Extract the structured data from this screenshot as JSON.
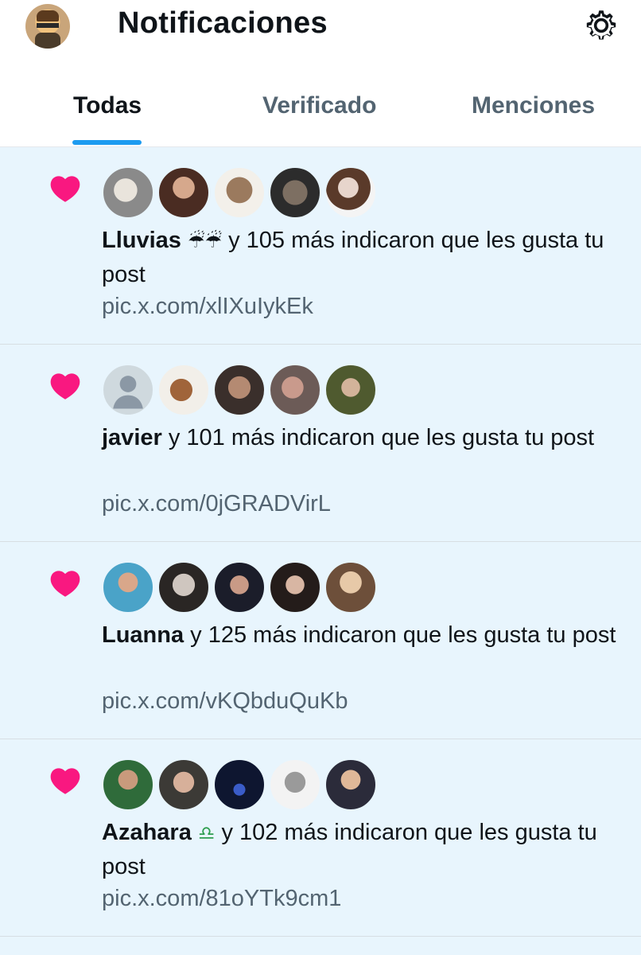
{
  "header": {
    "title": "Notificaciones",
    "settings_icon": "gear-icon"
  },
  "tabs": [
    {
      "label": "Todas",
      "active": true
    },
    {
      "label": "Verificado",
      "active": false
    },
    {
      "label": "Menciones",
      "active": false
    }
  ],
  "notifications": [
    {
      "name": "Lluvias",
      "emoji": "☔☔",
      "text": " y 105 más indicaron que les gusta tu post",
      "link": "pic.x.com/xlIXuIykEk"
    },
    {
      "name": "javier",
      "emoji": "",
      "text": " y 101 más indicaron que les gusta tu post",
      "link": "pic.x.com/0jGRADVirL"
    },
    {
      "name": "Luanna",
      "emoji": "",
      "text": " y 125 más indicaron que les gusta tu post",
      "link": "pic.x.com/vKQbduQuKb"
    },
    {
      "name": "Azahara",
      "emoji": "♎",
      "text": " y 102 más indicaron que les gusta tu post",
      "link": "pic.x.com/81oYTk9cm1"
    }
  ],
  "colors": {
    "accent": "#1d9bf0",
    "heart": "#f91880",
    "list_bg": "#e8f5fd",
    "muted": "#536471"
  }
}
